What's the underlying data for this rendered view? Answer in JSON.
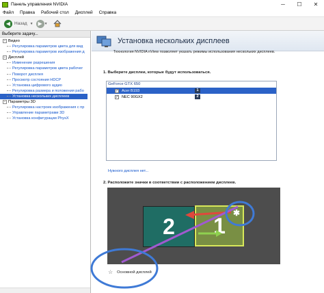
{
  "window": {
    "title": "Панель управления NVIDIA",
    "minimize": "─",
    "maximize": "☐",
    "close": "✕"
  },
  "menu": [
    "Файл",
    "Правка",
    "Рабочий стол",
    "Дисплей",
    "Справка"
  ],
  "toolbar": {
    "back_label": "Назад",
    "back_arrow": "◀",
    "forward_arrow": "▶",
    "dropdown": "▼"
  },
  "sidebar": {
    "header": "Выберите задачу...",
    "categories": [
      {
        "label": "Видео",
        "items": [
          "Регулировка параметров цвета для вид",
          "Регулировка параметров изображения д"
        ]
      },
      {
        "label": "Дисплей",
        "items": [
          "Изменение разрешения",
          "Регулировка параметров цвета рабочег",
          "Поворот дисплея",
          "Просмотр состояния HDCP",
          "Установка цифрового аудио",
          "Регулировка размера и положения рабо",
          "Установка нескольких дисплеев"
        ]
      },
      {
        "label": "Параметры 3D",
        "items": [
          "Регулировка настроек изображения с пр",
          "Управление параметрами 3D",
          "Установка конфигурации PhysX"
        ]
      }
    ]
  },
  "content": {
    "title": "Установка нескольких дисплеев",
    "description": "Технология NVIDIA nView позволяет указать режимы использования нескольких дисплеев.",
    "step1": "1. Выберите дисплеи, которые будут использоваться.",
    "gpu": "GeForce GTX 650",
    "displays": [
      {
        "name": "Acer B193",
        "number": "1",
        "checked": true,
        "selected": true
      },
      {
        "name": "NEC 90GX2",
        "number": "2",
        "checked": true,
        "selected": false
      }
    ],
    "missing_link": "Нужного дисплея нет...",
    "step2": "2. Расположите значки в соответствии с расположением дисплеев.",
    "monitor_left": "2",
    "monitor_right": "1",
    "primary_star": "✱",
    "primary_label": "Основной дисплей"
  },
  "colors": {
    "selection": "#2b62c7",
    "monitor1": "#798f44",
    "monitor2": "#1f6d64",
    "link": "#1255cc",
    "annotation": "#3f7ad6"
  }
}
